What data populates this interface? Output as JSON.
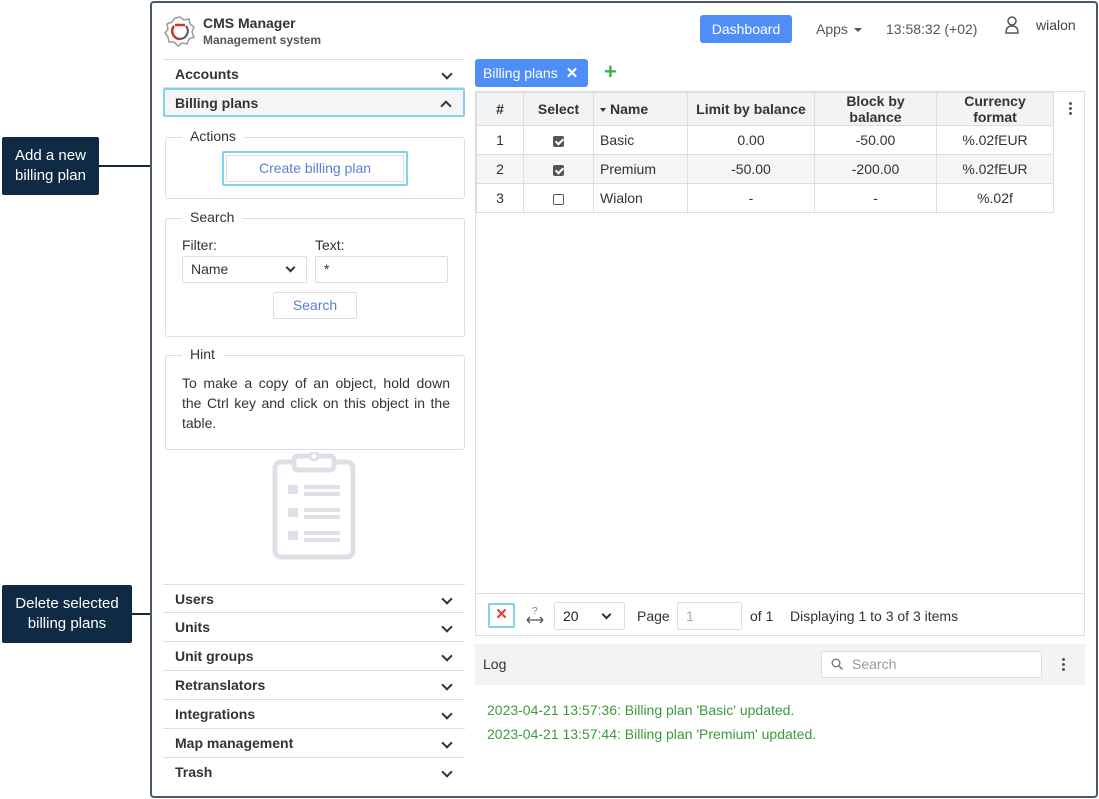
{
  "header": {
    "app_title": "CMS Manager",
    "app_subtitle": "Management system",
    "dashboard_label": "Dashboard",
    "apps_label": "Apps",
    "clock": "13:58:32 (+02)",
    "username": "wialon"
  },
  "sidebar": {
    "top_items": [
      {
        "label": "Accounts",
        "expanded": false
      },
      {
        "label": "Billing plans",
        "expanded": true
      }
    ],
    "actions": {
      "legend": "Actions",
      "create_label": "Create billing plan"
    },
    "search": {
      "legend": "Search",
      "filter_label": "Filter:",
      "filter_value": "Name",
      "text_label": "Text:",
      "text_value": "*",
      "button_label": "Search"
    },
    "hint": {
      "legend": "Hint",
      "text": "To make a copy of an object, hold down the Ctrl key and click on this object in the table."
    },
    "bottom_items": [
      {
        "label": "Users"
      },
      {
        "label": "Units"
      },
      {
        "label": "Unit groups"
      },
      {
        "label": "Retranslators"
      },
      {
        "label": "Integrations"
      },
      {
        "label": "Map management"
      },
      {
        "label": "Trash"
      }
    ]
  },
  "tabs": [
    {
      "label": "Billing plans"
    }
  ],
  "table": {
    "columns": [
      "#",
      "Select",
      "Name",
      "Limit by balance",
      "Block by balance",
      "Currency format"
    ],
    "sorted_column": "Name",
    "rows": [
      {
        "num": "1",
        "selected": true,
        "name": "Basic",
        "limit": "0.00",
        "block": "-50.00",
        "currency": "%.02fEUR"
      },
      {
        "num": "2",
        "selected": true,
        "name": "Premium",
        "limit": "-50.00",
        "block": "-200.00",
        "currency": "%.02fEUR"
      },
      {
        "num": "3",
        "selected": false,
        "name": "Wialon",
        "limit": "-",
        "block": "-",
        "currency": "%.02f"
      }
    ]
  },
  "pager": {
    "page_size": "20",
    "page_label": "Page",
    "page_value": "1",
    "of_label": "of 1",
    "display_text": "Displaying 1 to 3 of 3 items",
    "fit_icon_text": "?"
  },
  "log": {
    "title": "Log",
    "search_placeholder": "Search",
    "lines": [
      "2023-04-21 13:57:36: Billing plan 'Basic' updated.",
      "2023-04-21 13:57:44: Billing plan 'Premium' updated."
    ]
  },
  "callouts": {
    "add": "Add a new billing plan",
    "delete": "Delete selected billing plans"
  },
  "colors": {
    "accent": "#4f8ef7",
    "highlight": "#7fd3ea",
    "log_text": "#3d9a3d",
    "callout_bg": "#0f2a44",
    "delete_red": "#e53935",
    "add_green": "#3cb34a"
  }
}
